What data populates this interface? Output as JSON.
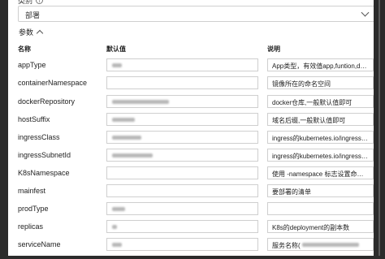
{
  "scope": {
    "label": "类别",
    "selected": "部署"
  },
  "params": {
    "toggle_label": "参数",
    "columns": {
      "name": "名称",
      "default": "默认值",
      "desc": "说明"
    },
    "rows": [
      {
        "name": "appType",
        "desc": "App类型，有效值app,funtion,dapr"
      },
      {
        "name": "containerNamespace",
        "desc": "镜像所在的命名空间"
      },
      {
        "name": "dockerRepository",
        "desc": "docker仓库,一般默认值即可"
      },
      {
        "name": "hostSuffix",
        "desc": "域名后缀,一般默认值即可"
      },
      {
        "name": "ingressClass",
        "desc": "ingress的kubernetes.io/ingress.class"
      },
      {
        "name": "ingressSubnetId",
        "desc": "ingress的kubernetes.io/ingress.subnetId"
      },
      {
        "name": "K8sNamespace",
        "desc": "使用 -namespace 标志设置命令的命名空间"
      },
      {
        "name": "mainfest",
        "desc": "要部署的清单"
      },
      {
        "name": "prodType",
        "desc": ""
      },
      {
        "name": "replicas",
        "desc": "K8s的deployment的副本数"
      },
      {
        "name": "serviceName",
        "desc": "服务名称("
      }
    ]
  }
}
